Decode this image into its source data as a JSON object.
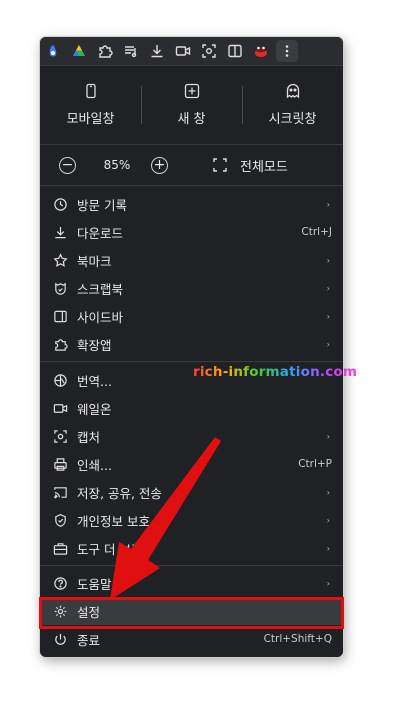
{
  "top_actions": [
    {
      "label": "모바일창",
      "icon": "mobile-window-icon"
    },
    {
      "label": "새 창",
      "icon": "new-window-icon"
    },
    {
      "label": "시크릿창",
      "icon": "secret-window-icon"
    }
  ],
  "zoom": {
    "value": "85%",
    "fullscreen_label": "전체모드",
    "minus": "−",
    "plus": "+"
  },
  "menu": {
    "history": {
      "label": "방문 기록",
      "arrow": "›"
    },
    "downloads": {
      "label": "다운로드",
      "shortcut": "Ctrl+J"
    },
    "bookmarks": {
      "label": "북마크",
      "arrow": "›"
    },
    "scrapbook": {
      "label": "스크랩북",
      "arrow": "›"
    },
    "sidebar": {
      "label": "사이드바",
      "arrow": "›"
    },
    "extensions": {
      "label": "확장앱",
      "arrow": "›"
    },
    "translate": {
      "label": "번역..."
    },
    "whale_on": {
      "label": "웨일온"
    },
    "capture": {
      "label": "캡처",
      "arrow": "›"
    },
    "print": {
      "label": "인쇄...",
      "shortcut": "Ctrl+P"
    },
    "save_share": {
      "label": "저장, 공유, 전송",
      "arrow": "›"
    },
    "privacy": {
      "label": "개인정보 보호",
      "arrow": "›"
    },
    "more_tools": {
      "label": "도구 더 보기",
      "arrow": "›"
    },
    "help": {
      "label": "도움말",
      "arrow": "›"
    },
    "settings": {
      "label": "설정"
    },
    "exit": {
      "label": "종료",
      "shortcut": "Ctrl+Shift+Q"
    }
  },
  "watermark": "rich-information.com",
  "colors": {
    "menu_bg": "#202124",
    "highlight": "#e01010",
    "arrow": "#e01010"
  }
}
